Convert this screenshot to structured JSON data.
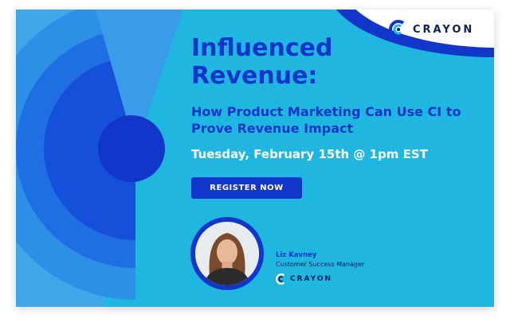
{
  "brand": {
    "name": "CRAYON"
  },
  "headline": {
    "title": "Influenced Revenue:",
    "subtitle": "How Product Marketing Can Use CI to Prove Revenue Impact"
  },
  "event": {
    "date": "Tuesday, February 15th @ 1pm EST"
  },
  "cta": {
    "register_label": "REGISTER NOW"
  },
  "speaker": {
    "name": "Liz Kavney",
    "role": "Customer Success Manager",
    "company": "CRAYON"
  },
  "colors": {
    "background": "#1fb6e0",
    "primary_blue": "#1136c9",
    "navy": "#0a1e5a",
    "white": "#ffffff"
  },
  "icons": [
    "crayon-logo-icon",
    "crayon-logo-small-icon"
  ]
}
